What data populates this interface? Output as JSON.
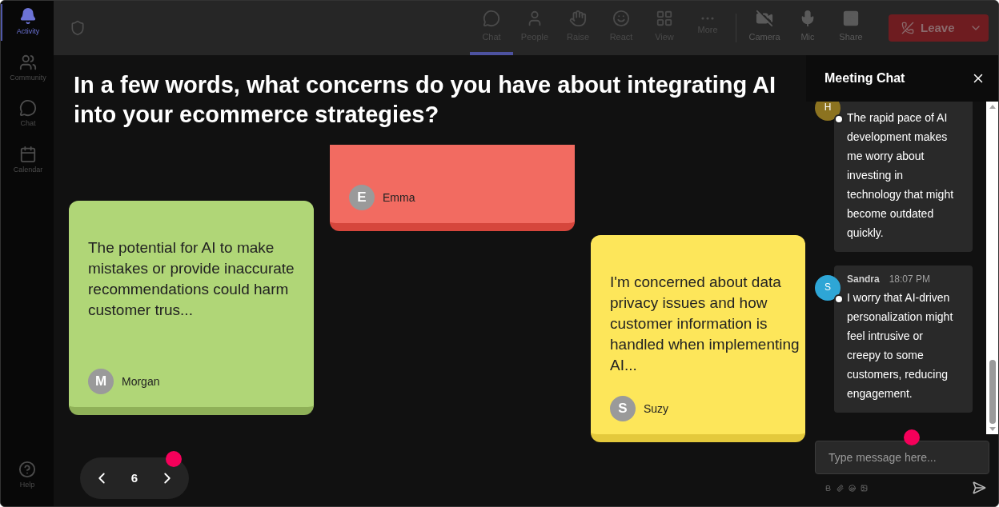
{
  "sidebar": {
    "items": [
      {
        "label": "Activity",
        "selected": true
      },
      {
        "label": "Community",
        "selected": false
      },
      {
        "label": "Chat",
        "selected": false
      },
      {
        "label": "Calendar",
        "selected": false
      }
    ],
    "help": "Help"
  },
  "toolbar": {
    "buttons": [
      {
        "label": "Chat",
        "selected": true
      },
      {
        "label": "People",
        "selected": false
      },
      {
        "label": "Raise",
        "selected": false
      },
      {
        "label": "React",
        "selected": false
      },
      {
        "label": "View",
        "selected": false
      },
      {
        "label": "More",
        "selected": false
      },
      {
        "label": "Camera",
        "selected": false
      },
      {
        "label": "Mic",
        "selected": false
      },
      {
        "label": "Share",
        "selected": false
      }
    ],
    "leave": "Leave"
  },
  "question": "In a few words, what concerns do you have about integrating AI into your ecommerce strategies?",
  "notes": [
    {
      "color": "#f26b61",
      "initial": "E",
      "author": "Emma"
    },
    {
      "color": "#b0d677",
      "initial": "M",
      "author": "Morgan",
      "text": "The potential for AI to make mistakes or provide inaccurate recommendations could harm customer trus..."
    },
    {
      "color": "#fde65a",
      "initial": "S",
      "author": "Suzy",
      "text": "I'm concerned about data privacy issues and how customer information is handled when implementing AI..."
    }
  ],
  "pager": {
    "page": "6"
  },
  "chat": {
    "title": "Meeting Chat",
    "messages": [
      {
        "initial": "H",
        "color": "#8c7320",
        "text": "The rapid pace of AI development makes me worry about investing in technology that might become outdated quickly."
      },
      {
        "initial": "S",
        "color": "#2ea6d6",
        "author": "Sandra",
        "time": "18:07 PM",
        "text": "I worry that AI-driven personalization might feel intrusive or creepy to some customers, reducing engagement."
      }
    ],
    "input": {
      "placeholder": "Type message here..."
    }
  }
}
